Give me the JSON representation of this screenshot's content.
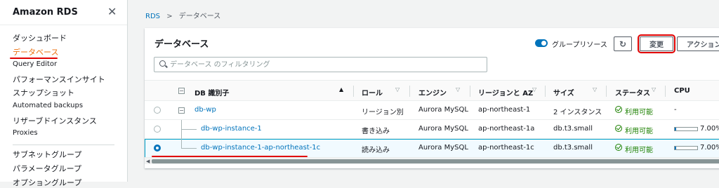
{
  "sidebar": {
    "title": "Amazon RDS",
    "items": [
      {
        "label": "ダッシュボード",
        "active": false
      },
      {
        "label": "データベース",
        "active": true
      },
      {
        "label": "Query Editor",
        "active": false
      },
      {
        "label": "パフォーマンスインサイト",
        "active": false
      },
      {
        "label": "スナップショット",
        "active": false
      },
      {
        "label": "Automated backups",
        "active": false
      },
      {
        "label": "リザーブドインスタンス",
        "active": false
      },
      {
        "label": "Proxies",
        "active": false
      },
      {
        "label": "サブネットグループ",
        "active": false
      },
      {
        "label": "パラメータグループ",
        "active": false
      },
      {
        "label": "オプショングループ",
        "active": false
      }
    ]
  },
  "breadcrumb": {
    "root": "RDS",
    "separator": ">",
    "current": "データベース"
  },
  "panel": {
    "title": "データベース",
    "group_toggle_label": "グループリソース",
    "modify_label": "変更",
    "actions_label": "アクション",
    "search_placeholder": "データベース のフィルタリング"
  },
  "table": {
    "headers": [
      "DB 識別子",
      "ロール",
      "エンジン",
      "リージョンと AZ",
      "サイズ",
      "ステータス",
      "CPU"
    ],
    "rows": [
      {
        "id": "db-wp",
        "role": "リージョン別",
        "engine": "Aurora MySQL",
        "region": "ap-northeast-1",
        "size": "2 インスタンス",
        "status": "利用可能",
        "cpu": "-",
        "cpu_fraction": null,
        "selected": false
      },
      {
        "id": "db-wp-instance-1",
        "role": "書き込み",
        "engine": "Aurora MySQL",
        "region": "ap-northeast-1a",
        "size": "db.t3.small",
        "status": "利用可能",
        "cpu": "7.00%",
        "cpu_fraction": 0.07,
        "selected": false
      },
      {
        "id": "db-wp-instance-1-ap-northeast-1c",
        "role": "読み込み",
        "engine": "Aurora MySQL",
        "region": "ap-northeast-1c",
        "size": "db.t3.small",
        "status": "利用可能",
        "cpu": "7.00%",
        "cpu_fraction": 0.07,
        "selected": true
      }
    ]
  },
  "colors": {
    "accent": "#0073bb",
    "active_nav": "#ec7211",
    "status_ok": "#1d8102",
    "highlight": "#e00000"
  }
}
